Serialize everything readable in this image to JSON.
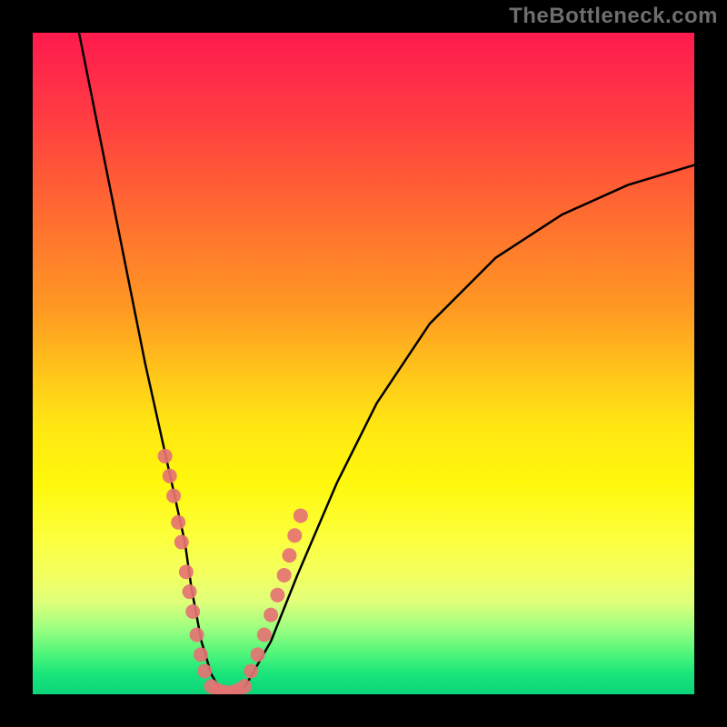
{
  "watermark": "TheBottleneck.com",
  "chart_data": {
    "type": "line",
    "title": "",
    "xlabel": "",
    "ylabel": "",
    "xlim": [
      0,
      100
    ],
    "ylim": [
      0,
      100
    ],
    "grid": false,
    "legend": false,
    "background_gradient": {
      "top": "#ff1a4d",
      "bottom": "#0cd47a",
      "description": "vertical rainbow gradient red→orange→yellow→green"
    },
    "series": [
      {
        "name": "bottleneck-curve",
        "stroke": "#000000",
        "x": [
          7,
          9,
          11,
          13,
          15,
          17,
          19,
          21,
          23,
          24,
          25.5,
          27,
          28.5,
          30,
          32,
          36,
          40,
          46,
          52,
          60,
          70,
          80,
          90,
          100
        ],
        "y": [
          100,
          90,
          80,
          70,
          60,
          50,
          41,
          32,
          23,
          16,
          8,
          3,
          0.5,
          0,
          1,
          8,
          18,
          32,
          44,
          56,
          66,
          72.5,
          77,
          80
        ]
      }
    ],
    "markers": [
      {
        "name": "left-cluster",
        "color": "#e57373",
        "points": [
          {
            "x": 20.0,
            "y": 36
          },
          {
            "x": 20.7,
            "y": 33
          },
          {
            "x": 21.3,
            "y": 30
          },
          {
            "x": 22.0,
            "y": 26
          },
          {
            "x": 22.5,
            "y": 23
          },
          {
            "x": 23.2,
            "y": 18.5
          },
          {
            "x": 23.7,
            "y": 15.5
          },
          {
            "x": 24.2,
            "y": 12.5
          },
          {
            "x": 24.8,
            "y": 9
          },
          {
            "x": 25.4,
            "y": 6
          },
          {
            "x": 26.0,
            "y": 3.5
          }
        ]
      },
      {
        "name": "bottom-cluster",
        "color": "#e57373",
        "points": [
          {
            "x": 27.0,
            "y": 1.2
          },
          {
            "x": 28.0,
            "y": 0.6
          },
          {
            "x": 29.0,
            "y": 0.3
          },
          {
            "x": 30.0,
            "y": 0.3
          },
          {
            "x": 31.0,
            "y": 0.6
          },
          {
            "x": 32.0,
            "y": 1.2
          }
        ]
      },
      {
        "name": "right-cluster",
        "color": "#e57373",
        "points": [
          {
            "x": 33.0,
            "y": 3.5
          },
          {
            "x": 34.0,
            "y": 6
          },
          {
            "x": 35.0,
            "y": 9
          },
          {
            "x": 36.0,
            "y": 12
          },
          {
            "x": 37.0,
            "y": 15
          },
          {
            "x": 38.0,
            "y": 18
          },
          {
            "x": 38.8,
            "y": 21
          },
          {
            "x": 39.6,
            "y": 24
          },
          {
            "x": 40.5,
            "y": 27
          }
        ]
      }
    ]
  }
}
